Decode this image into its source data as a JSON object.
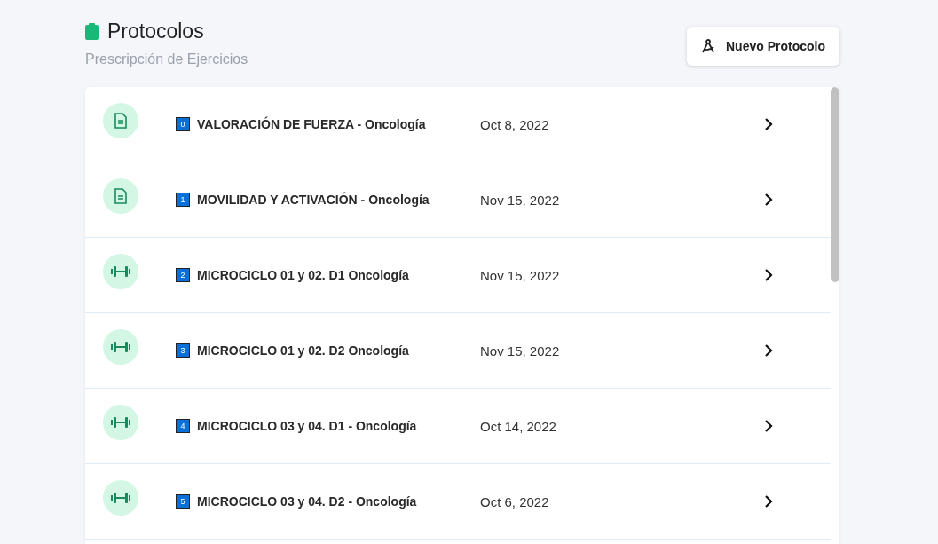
{
  "header": {
    "title": "Protocolos",
    "subtitle": "Prescripción de Ejercicios"
  },
  "new_button": {
    "label": "Nuevo Protocolo"
  },
  "protocols": [
    {
      "kind": "document",
      "index": "0",
      "name": "VALORACIÓN DE FUERZA - Oncología",
      "date": "Oct 8, 2022"
    },
    {
      "kind": "document",
      "index": "1",
      "name": "MOVILIDAD Y ACTIVACIÓN - Oncología",
      "date": "Nov 15, 2022"
    },
    {
      "kind": "exercise",
      "index": "2",
      "name": "MICROCICLO 01 y 02. D1 Oncología",
      "date": "Nov 15, 2022"
    },
    {
      "kind": "exercise",
      "index": "3",
      "name": "MICROCICLO 01 y 02. D2 Oncología",
      "date": "Nov 15, 2022"
    },
    {
      "kind": "exercise",
      "index": "4",
      "name": "MICROCICLO 03 y 04. D1 - Oncología",
      "date": "Oct 14, 2022"
    },
    {
      "kind": "exercise",
      "index": "5",
      "name": "MICROCICLO 03 y 04. D2 - Oncología",
      "date": "Oct 6, 2022"
    }
  ]
}
